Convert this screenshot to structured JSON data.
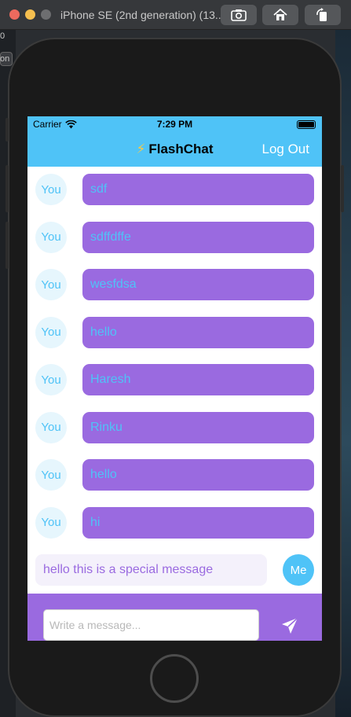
{
  "window": {
    "title": "iPhone SE (2nd generation) (13..."
  },
  "backdrop": {
    "left_labels": [
      "0",
      "on"
    ]
  },
  "status_bar": {
    "carrier": "Carrier",
    "time": "7:29 PM"
  },
  "nav": {
    "bolt_icon": "⚡",
    "title": "FlashChat",
    "logout_label": "Log Out"
  },
  "messages": [
    {
      "sender": "You",
      "text": "sdf"
    },
    {
      "sender": "You",
      "text": "sdffdffe"
    },
    {
      "sender": "You",
      "text": "wesfdsa"
    },
    {
      "sender": "You",
      "text": "hello"
    },
    {
      "sender": "You",
      "text": "Haresh"
    },
    {
      "sender": "You",
      "text": "Rinku"
    },
    {
      "sender": "You",
      "text": "hello"
    },
    {
      "sender": "You",
      "text": "hi"
    }
  ],
  "my_message": {
    "sender": "Me",
    "text": "hello this is a special message"
  },
  "composer": {
    "placeholder": "Write a message...",
    "value": "",
    "send_icon": "paperplane-icon"
  },
  "colors": {
    "nav_background": "#4fc3f7",
    "bubble_purple": "#9a6ae0",
    "bubble_text_blue": "#4fc3f7",
    "me_bubble_light": "#f4f1fb"
  }
}
